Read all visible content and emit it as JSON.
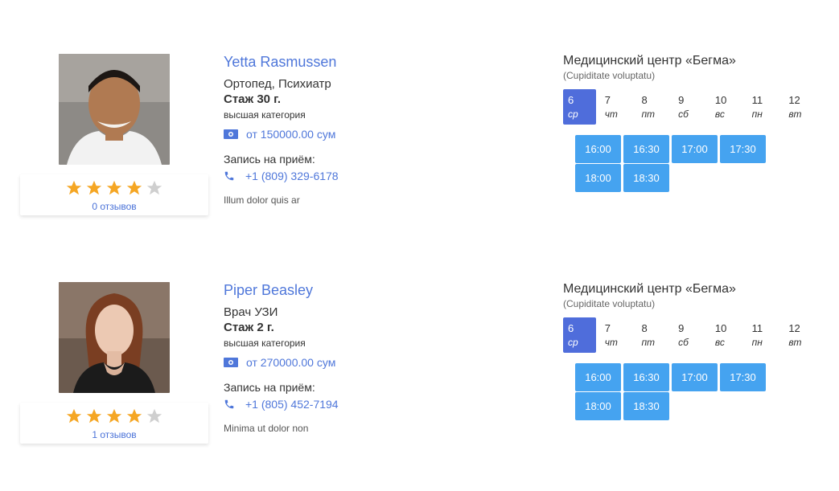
{
  "doctors": [
    {
      "name": "Yetta Rasmussen",
      "specialty": "Ортопед, Психиатр",
      "experience": "Стаж 30 г.",
      "category": "высшая категория",
      "price": "от 150000.00 сум",
      "appointment_label": "Запись на приём:",
      "phone": "+1 (809) 329-6178",
      "about": "Illum dolor quis ar",
      "rating": 4,
      "rating_max": 5,
      "reviews": "0 отзывов",
      "clinic": {
        "name": "Медицинский центр «Бегма»",
        "subtitle": "(Cupiditate voluptatu)",
        "days": [
          {
            "num": "6",
            "dow": "ср",
            "active": true
          },
          {
            "num": "7",
            "dow": "чт",
            "active": false
          },
          {
            "num": "8",
            "dow": "пт",
            "active": false
          },
          {
            "num": "9",
            "dow": "сб",
            "active": false
          },
          {
            "num": "10",
            "dow": "вс",
            "active": false
          },
          {
            "num": "11",
            "dow": "пн",
            "active": false
          },
          {
            "num": "12",
            "dow": "вт",
            "active": false
          }
        ],
        "slots": [
          "16:00",
          "16:30",
          "17:00",
          "17:30",
          "18:00",
          "18:30"
        ]
      }
    },
    {
      "name": "Piper Beasley",
      "specialty": "Врач УЗИ",
      "experience": "Стаж 2 г.",
      "category": "высшая категория",
      "price": "от 270000.00 сум",
      "appointment_label": "Запись на приём:",
      "phone": "+1 (805) 452-7194",
      "about": "Minima ut dolor non",
      "rating": 4,
      "rating_max": 5,
      "reviews": "1 отзывов",
      "clinic": {
        "name": "Медицинский центр «Бегма»",
        "subtitle": "(Cupiditate voluptatu)",
        "days": [
          {
            "num": "6",
            "dow": "ср",
            "active": true
          },
          {
            "num": "7",
            "dow": "чт",
            "active": false
          },
          {
            "num": "8",
            "dow": "пт",
            "active": false
          },
          {
            "num": "9",
            "dow": "сб",
            "active": false
          },
          {
            "num": "10",
            "dow": "вс",
            "active": false
          },
          {
            "num": "11",
            "dow": "пн",
            "active": false
          },
          {
            "num": "12",
            "dow": "вт",
            "active": false
          }
        ],
        "slots": [
          "16:00",
          "16:30",
          "17:00",
          "17:30",
          "18:00",
          "18:30"
        ]
      }
    }
  ],
  "colors": {
    "link": "#4f77da",
    "active_day": "#4f6ddb",
    "slot": "#45a3f0",
    "star_filled": "#f5a623",
    "star_empty": "#cfcfcf"
  },
  "icons": {
    "price": "money-icon",
    "phone": "phone-icon",
    "star": "star-icon"
  }
}
